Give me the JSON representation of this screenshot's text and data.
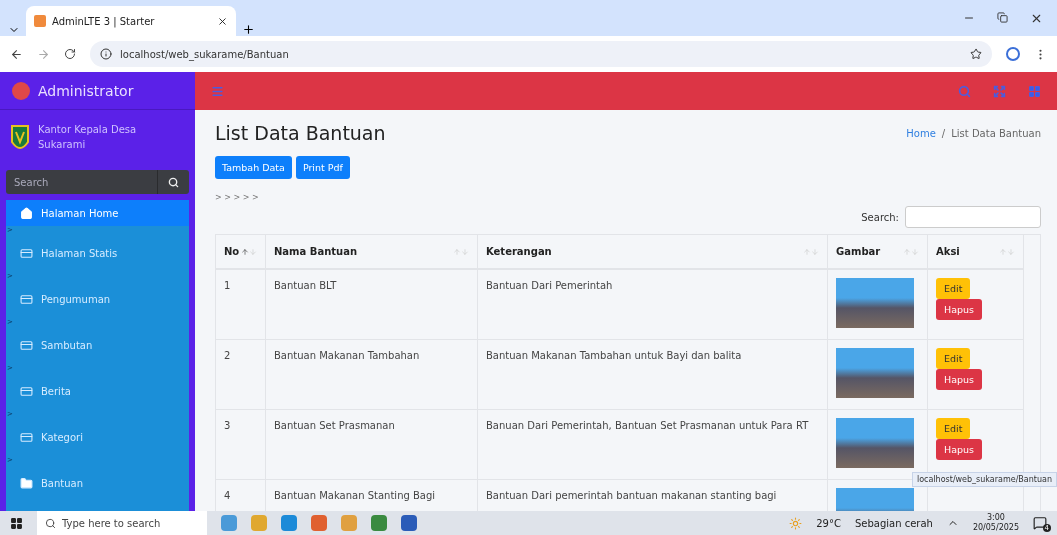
{
  "browser": {
    "tab_title": "AdminLTE 3 | Starter",
    "url": "localhost/web_sukarame/Bantuan",
    "status_url": "localhost/web_sukarame/Bantuan"
  },
  "brand": {
    "name": "Administrator"
  },
  "sidebar": {
    "org_name": "Kantor Kepala Desa Sukarami",
    "search_placeholder": "Search",
    "items": [
      {
        "label": "Halaman Home",
        "kind": "home",
        "marker": "",
        "selected": true
      },
      {
        "label": "Halaman Statis",
        "kind": "page",
        "marker": ">",
        "selected": false
      },
      {
        "label": "Pengumuman",
        "kind": "page",
        "marker": ">",
        "selected": false
      },
      {
        "label": "Sambutan",
        "kind": "page",
        "marker": ">",
        "selected": false
      },
      {
        "label": "Berita",
        "kind": "page",
        "marker": ">",
        "selected": false
      },
      {
        "label": "Kategori",
        "kind": "page",
        "marker": ">",
        "selected": false
      },
      {
        "label": "Bantuan",
        "kind": "folder",
        "marker": ">",
        "selected": false
      }
    ]
  },
  "content": {
    "title": "List Data Bantuan",
    "breadcrumb": [
      {
        "label": "Home",
        "link": true
      },
      {
        "label": "List Data Bantuan",
        "link": false
      }
    ],
    "breadcrumb_separator": "/",
    "buttons": [
      "Tambah Data",
      "Print Pdf"
    ],
    "pager": "> > > > >",
    "search_label": "Search:",
    "table": {
      "columns": [
        {
          "label": "No",
          "sorted": true
        },
        {
          "label": "Nama Bantuan",
          "sorted": false
        },
        {
          "label": "Keterangan",
          "sorted": false
        },
        {
          "label": "Gambar",
          "sorted": false
        },
        {
          "label": "Aksi",
          "sorted": false
        }
      ],
      "rows": [
        {
          "no": "1",
          "name": "Bantuan BLT",
          "desc": "Bantuan Dari Pemerintah",
          "actions": [
            "Edit",
            "Hapus"
          ]
        },
        {
          "no": "2",
          "name": "Bantuan Makanan Tambahan",
          "desc": "Bantuan Makanan Tambahan untuk Bayi dan balita",
          "actions": [
            "Edit",
            "Hapus"
          ]
        },
        {
          "no": "3",
          "name": "Bantuan Set Prasmanan",
          "desc": "Banuan Dari Pemerintah, Bantuan Set Prasmanan untuk Para RT",
          "actions": [
            "Edit",
            "Hapus"
          ]
        },
        {
          "no": "4",
          "name": "Bantuan Makanan Stanting Bagi",
          "desc": "Bantuan Dari pemerintah bantuan makanan stanting bagi",
          "actions": []
        }
      ]
    }
  },
  "taskbar": {
    "search_placeholder": "Type here to search",
    "temperature": "29°C",
    "weather": "Sebagian cerah",
    "time": "3:00",
    "date": "20/05/2025",
    "notifications": "4"
  }
}
